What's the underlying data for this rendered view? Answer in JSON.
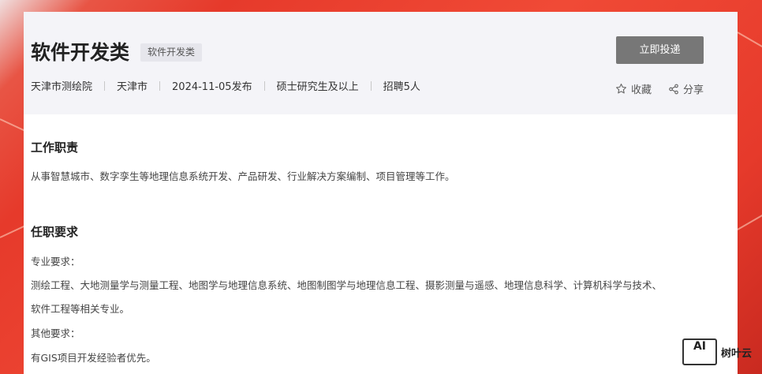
{
  "job": {
    "title": "软件开发类",
    "tag": "软件开发类",
    "meta": [
      "天津市测绘院",
      "天津市",
      "2024-11-05发布",
      "硕士研究生及以上",
      "招聘5人"
    ]
  },
  "actions": {
    "apply_label": "立即投递",
    "favorite_label": "收藏",
    "share_label": "分享"
  },
  "sections": {
    "duties_title": "工作职责",
    "duties_text": "从事智慧城市、数字孪生等地理信息系统开发、产品研发、行业解决方案编制、项目管理等工作。",
    "requirements_title": "任职要求",
    "req_major_label": "专业要求：",
    "req_major_line1": "测绘工程、大地测量学与测量工程、地图学与地理信息系统、地图制图学与地理信息工程、摄影测量与遥感、地理信息科学、计算机科学与技术、",
    "req_major_line2": "软件工程等相关专业。",
    "req_other_label": "其他要求：",
    "req_other_text": "有GIS项目开发经验者优先。"
  },
  "watermark": {
    "box_text": "AI",
    "brand_text": "树叶云"
  },
  "colors": {
    "background_red": "#e63a2b",
    "header_bg": "#f4f4f8",
    "apply_button": "#777777"
  }
}
